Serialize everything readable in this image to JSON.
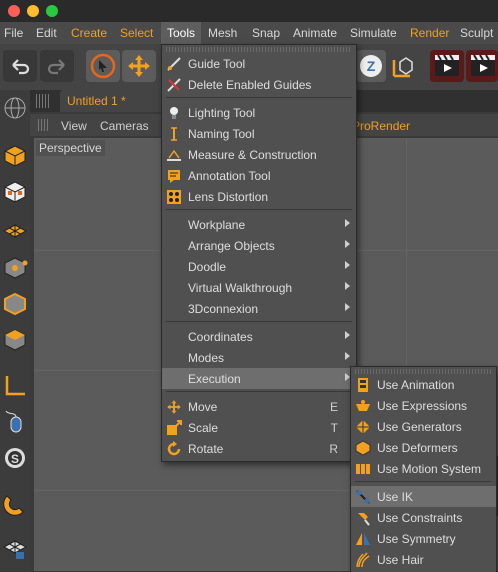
{
  "colors": {
    "accent": "#f2a020",
    "menu_bg": "#505050",
    "highlight": "#6e6e6e"
  },
  "menubar": [
    {
      "label": "File",
      "style": "normal"
    },
    {
      "label": "Edit",
      "style": "normal"
    },
    {
      "label": "Create",
      "style": "orange"
    },
    {
      "label": "Select",
      "style": "orange"
    },
    {
      "label": "Tools",
      "style": "active"
    },
    {
      "label": "Mesh",
      "style": "normal"
    },
    {
      "label": "Snap",
      "style": "normal"
    },
    {
      "label": "Animate",
      "style": "normal"
    },
    {
      "label": "Simulate",
      "style": "normal"
    },
    {
      "label": "Render",
      "style": "orange"
    },
    {
      "label": "Sculpt",
      "style": "normal"
    }
  ],
  "document": {
    "tab_title": "Untitled 1 *"
  },
  "view_menu": {
    "view": "View",
    "cameras": "Cameras",
    "prorender": "ProRender"
  },
  "viewport": {
    "label": "Perspective"
  },
  "tools_menu": {
    "tools": [
      {
        "label": "Guide Tool",
        "icon": "guide-tool-icon"
      },
      {
        "label": "Delete Enabled Guides",
        "icon": "delete-guides-icon"
      }
    ],
    "tools2": [
      {
        "label": "Lighting Tool",
        "icon": "lighting-tool-icon"
      },
      {
        "label": "Naming Tool",
        "icon": "naming-tool-icon"
      },
      {
        "label": "Measure & Construction",
        "icon": "measure-icon"
      },
      {
        "label": "Annotation Tool",
        "icon": "annotation-icon"
      },
      {
        "label": "Lens Distortion",
        "icon": "lens-distortion-icon"
      }
    ],
    "submenus1": [
      {
        "label": "Workplane"
      },
      {
        "label": "Arrange Objects"
      },
      {
        "label": "Doodle"
      },
      {
        "label": "Virtual Walkthrough"
      },
      {
        "label": "3Dconnexion"
      }
    ],
    "submenus2": [
      {
        "label": "Coordinates"
      },
      {
        "label": "Modes"
      },
      {
        "label": "Execution"
      }
    ],
    "transforms": [
      {
        "label": "Move",
        "shortcut": "E",
        "icon": "move-icon"
      },
      {
        "label": "Scale",
        "shortcut": "T",
        "icon": "scale-icon"
      },
      {
        "label": "Rotate",
        "shortcut": "R",
        "icon": "rotate-icon"
      }
    ]
  },
  "execution_menu": {
    "group1": [
      {
        "label": "Use Animation",
        "icon": "animation-icon"
      },
      {
        "label": "Use Expressions",
        "icon": "expressions-icon"
      },
      {
        "label": "Use Generators",
        "icon": "generators-icon"
      },
      {
        "label": "Use Deformers",
        "icon": "deformers-icon"
      },
      {
        "label": "Use Motion System",
        "icon": "motion-system-icon"
      }
    ],
    "group2": [
      {
        "label": "Use IK",
        "icon": "ik-icon"
      },
      {
        "label": "Use Constraints",
        "icon": "constraints-icon"
      },
      {
        "label": "Use Symmetry",
        "icon": "symmetry-icon"
      },
      {
        "label": "Use Hair",
        "icon": "hair-icon"
      }
    ]
  }
}
